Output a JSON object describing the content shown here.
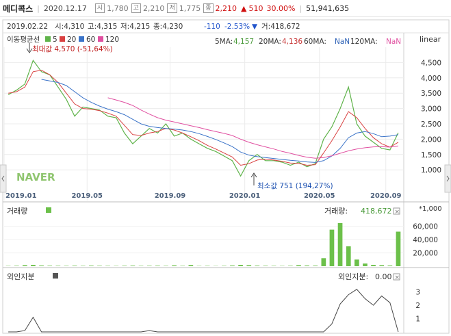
{
  "header": {
    "name": "메디콕스",
    "date": "2020.12.17",
    "open_tag": "시",
    "open": "1,780",
    "high_tag": "고",
    "high": "2,210",
    "low_tag": "저",
    "low": "1,775",
    "close_tag": "종",
    "close": "2,210",
    "change_arrow": "▲",
    "change": "510",
    "change_pct": "30.00%",
    "volume": "51,941,635"
  },
  "info": {
    "date": "2019.02.22",
    "open": "시:4,310",
    "high": "고:4,315",
    "low": "저:4,215",
    "close": "종:4,230",
    "change": "-110",
    "change_pct": "-2.53%",
    "arrow": "▼",
    "volume": "거:418,672"
  },
  "ma": {
    "title": "이동평균선",
    "items": [
      {
        "label": "5",
        "color": "#5fb34a"
      },
      {
        "label": "20",
        "color": "#d94040"
      },
      {
        "label": "60",
        "color": "#3a73c8"
      },
      {
        "label": "120",
        "color": "#e04fa0"
      }
    ],
    "readout": [
      {
        "label": "5MA:",
        "value": "4,157",
        "color": "#4a9a3a"
      },
      {
        "label": "20MA:",
        "value": "4,136",
        "color": "#c53030"
      },
      {
        "label": "60MA:",
        "value": "NaN",
        "color": "#2a5fb5"
      },
      {
        "label": "120MA:",
        "value": "NaN",
        "color": "#e04fa0"
      }
    ],
    "scale_label": "linear"
  },
  "annotations": {
    "max": "최대값 4,570 (-51,64%)",
    "min": "최소값 751 (194,27%)"
  },
  "watermark": "NAVER",
  "volume_panel": {
    "title": "거래량",
    "readout_label": "거래량:",
    "readout_value": "418,672",
    "unit": "*1,000",
    "close_icon": "×"
  },
  "foreign_panel": {
    "title": "외인지분",
    "readout_label": "외인지분:",
    "readout_value": "0.00",
    "close_icon": "×"
  },
  "colors": {
    "up": "#d01010",
    "down": "#2255cc",
    "volume": "#6cc04a",
    "grid": "#e8e8e8"
  },
  "chart_data": {
    "type": "line",
    "x_ticks": [
      "2019.01",
      "2019.05",
      "2019.09",
      "2020.01",
      "2020.05",
      "2020.09"
    ],
    "price": {
      "ylim": [
        0,
        5000
      ],
      "y_ticks": [
        1000,
        1500,
        2000,
        2500,
        3000,
        3500,
        4000,
        4500
      ],
      "y_tick_labels": [
        "1,000",
        "1,500",
        "2,000",
        "2,500",
        "3,000",
        "3,500",
        "4,000",
        "4,500"
      ],
      "series": [
        {
          "name": "5",
          "color": "#5fb34a",
          "values": [
            3450,
            3600,
            3800,
            4570,
            4200,
            4100,
            3700,
            3300,
            2750,
            3050,
            3000,
            2950,
            2750,
            2700,
            2200,
            1850,
            2100,
            2350,
            2200,
            2500,
            2100,
            2200,
            2000,
            1850,
            1700,
            1600,
            1450,
            1300,
            800,
            1300,
            1500,
            1300,
            1300,
            1250,
            1150,
            1250,
            1100,
            1200,
            2000,
            2400,
            3000,
            3700,
            2500,
            2100,
            1900,
            1700,
            1650,
            2210
          ]
        },
        {
          "name": "20",
          "color": "#d94040",
          "values": [
            3500,
            3550,
            3700,
            4200,
            4250,
            4100,
            3850,
            3500,
            3150,
            3000,
            2980,
            2930,
            2850,
            2750,
            2450,
            2150,
            2120,
            2200,
            2250,
            2350,
            2300,
            2200,
            2080,
            1950,
            1800,
            1680,
            1550,
            1420,
            1150,
            1200,
            1320,
            1350,
            1320,
            1280,
            1220,
            1210,
            1150,
            1170,
            1550,
            1950,
            2400,
            2900,
            2700,
            2350,
            2050,
            1850,
            1740,
            1900
          ]
        },
        {
          "name": "60",
          "color": "#3a73c8",
          "values": [
            null,
            null,
            null,
            null,
            3950,
            3900,
            3850,
            3750,
            3550,
            3350,
            3200,
            3080,
            2980,
            2900,
            2800,
            2650,
            2500,
            2420,
            2380,
            2350,
            2330,
            2300,
            2250,
            2180,
            2090,
            1990,
            1880,
            1760,
            1580,
            1480,
            1430,
            1400,
            1370,
            1340,
            1310,
            1290,
            1260,
            1240,
            1300,
            1450,
            1700,
            2050,
            2200,
            2250,
            2180,
            2080,
            2100,
            2150
          ]
        },
        {
          "name": "120",
          "color": "#e04fa0",
          "values": [
            null,
            null,
            null,
            null,
            null,
            null,
            null,
            null,
            null,
            null,
            null,
            null,
            3350,
            3280,
            3200,
            3100,
            2950,
            2820,
            2700,
            2620,
            2560,
            2500,
            2440,
            2380,
            2310,
            2250,
            2190,
            2120,
            2000,
            1900,
            1820,
            1750,
            1680,
            1600,
            1540,
            1470,
            1410,
            1380,
            1400,
            1460,
            1540,
            1620,
            1680,
            1720,
            1750,
            1760,
            1740,
            1780
          ]
        }
      ]
    },
    "volume": {
      "name": "거래량",
      "unit": "*1,000",
      "ylim": [
        0,
        70000
      ],
      "y_ticks": [
        20000,
        40000,
        60000
      ],
      "y_tick_labels": [
        "20,000",
        "40,000",
        "60,000"
      ],
      "values": [
        400,
        600,
        1500,
        2000,
        1000,
        700,
        600,
        500,
        700,
        500,
        800,
        600,
        500,
        400,
        600,
        800,
        500,
        600,
        700,
        500,
        1200,
        500,
        1800,
        400,
        500,
        300,
        500,
        1000,
        2000,
        1500,
        800,
        600,
        500,
        400,
        600,
        1500,
        1000,
        800,
        12000,
        55000,
        65000,
        30000,
        10000,
        4000,
        2000,
        1500,
        1000,
        51942
      ]
    },
    "foreign": {
      "name": "외인지분",
      "ylim": [
        0,
        3.5
      ],
      "y_ticks": [
        1,
        2,
        3
      ],
      "values": [
        0,
        0,
        0.1,
        1.1,
        0,
        0,
        0,
        0,
        0,
        0,
        0,
        0,
        0,
        0,
        0,
        0,
        0,
        0.1,
        0,
        0,
        0,
        0,
        0,
        0,
        0,
        0,
        0,
        0,
        0,
        0,
        0,
        0,
        0,
        0,
        0,
        0,
        0,
        0,
        0,
        0.6,
        2.1,
        2.8,
        3.2,
        2.5,
        2.0,
        2.7,
        2.2,
        0
      ]
    }
  }
}
